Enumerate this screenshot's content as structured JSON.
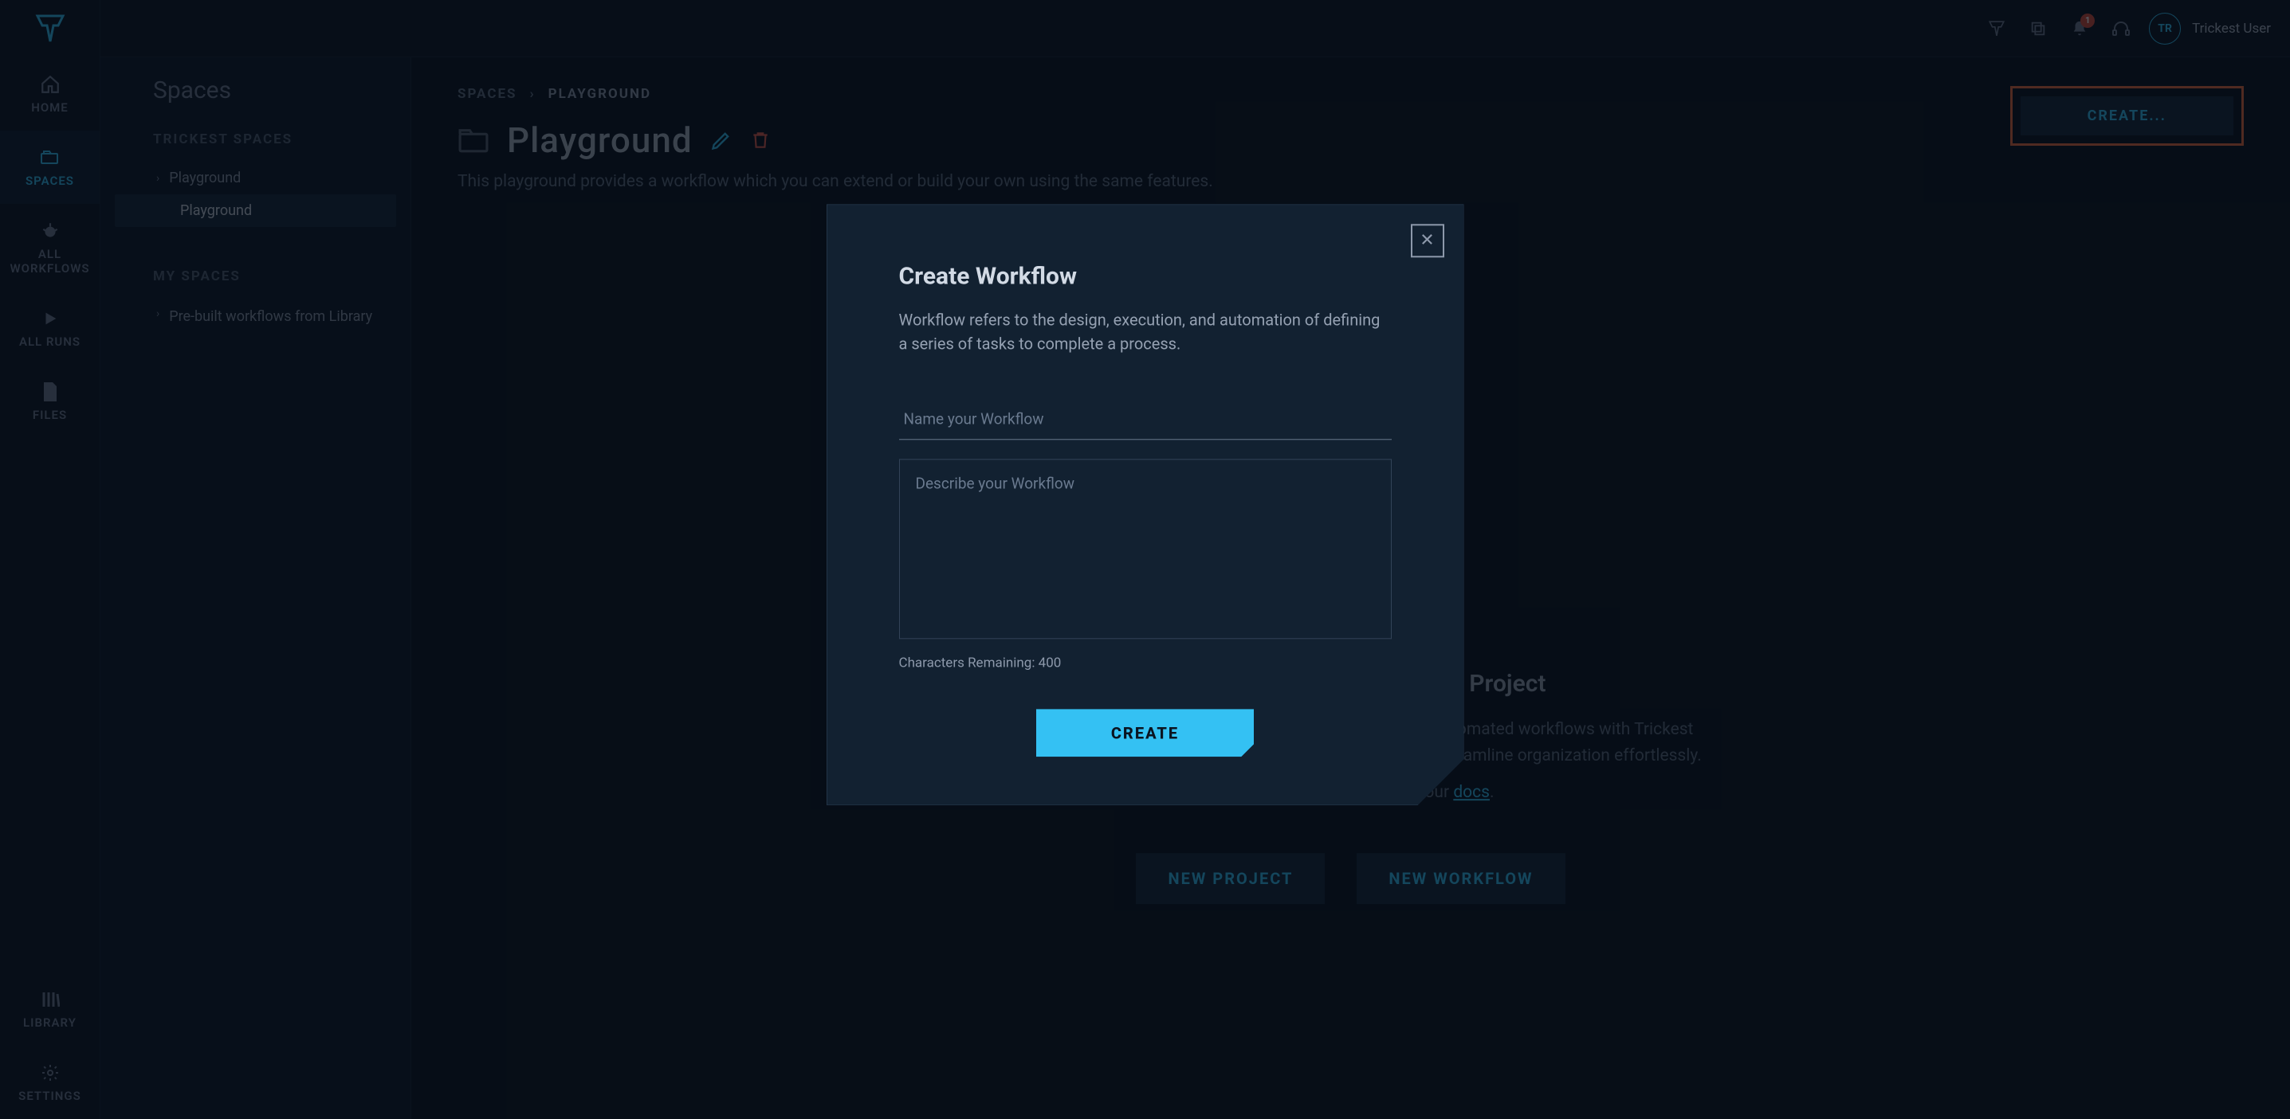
{
  "colors": {
    "accent": "#34c1f3",
    "danger": "#e05b4c",
    "warn": "#e96a3c"
  },
  "top": {
    "notif_count": "1",
    "avatar_initials": "TR",
    "username": "Trickest User"
  },
  "rail": {
    "items": [
      {
        "label": "HOME"
      },
      {
        "label": "SPACES",
        "active": true
      },
      {
        "label": "ALL WORKFLOWS"
      },
      {
        "label": "ALL RUNS"
      },
      {
        "label": "FILES"
      }
    ],
    "lower": [
      {
        "label": "LIBRARY"
      },
      {
        "label": "SETTINGS"
      }
    ]
  },
  "sidebar": {
    "title": "Spaces",
    "sections": [
      {
        "heading": "TRICKEST SPACES",
        "items": [
          {
            "label": "Playground",
            "expandable": true
          },
          {
            "label": "Playground",
            "child": true,
            "selected": true
          }
        ]
      },
      {
        "heading": "MY SPACES",
        "items": [
          {
            "label": "Pre-built workflows from Library",
            "expandable": true
          }
        ]
      }
    ]
  },
  "main": {
    "breadcrumb": {
      "root": "SPACES",
      "current": "PLAYGROUND"
    },
    "title": "Playground",
    "subtitle": "This playground provides a workflow which you can extend or build your own using the same features.",
    "create_button": "CREATE...",
    "hero": {
      "title": "Create your first Workflow or Project",
      "body": "A Project is a playground for creating and managing your automated workflows with Trickest tools, managing your inputs, using our specialized IDE and streamline organization effortlessly.",
      "more_prefix": "Learn more about projects in our ",
      "docs": "docs",
      "more_suffix": ".",
      "btn_project": "NEW PROJECT",
      "btn_workflow": "NEW WORKFLOW"
    }
  },
  "modal": {
    "title": "Create Workflow",
    "description": "Workflow refers to the design, execution, and automation of defining a series of tasks to complete a process.",
    "name_placeholder": "Name your Workflow",
    "desc_placeholder": "Describe your Workflow",
    "char_remaining_label": "Characters Remaining: ",
    "char_remaining_val": "400",
    "submit": "CREATE"
  }
}
